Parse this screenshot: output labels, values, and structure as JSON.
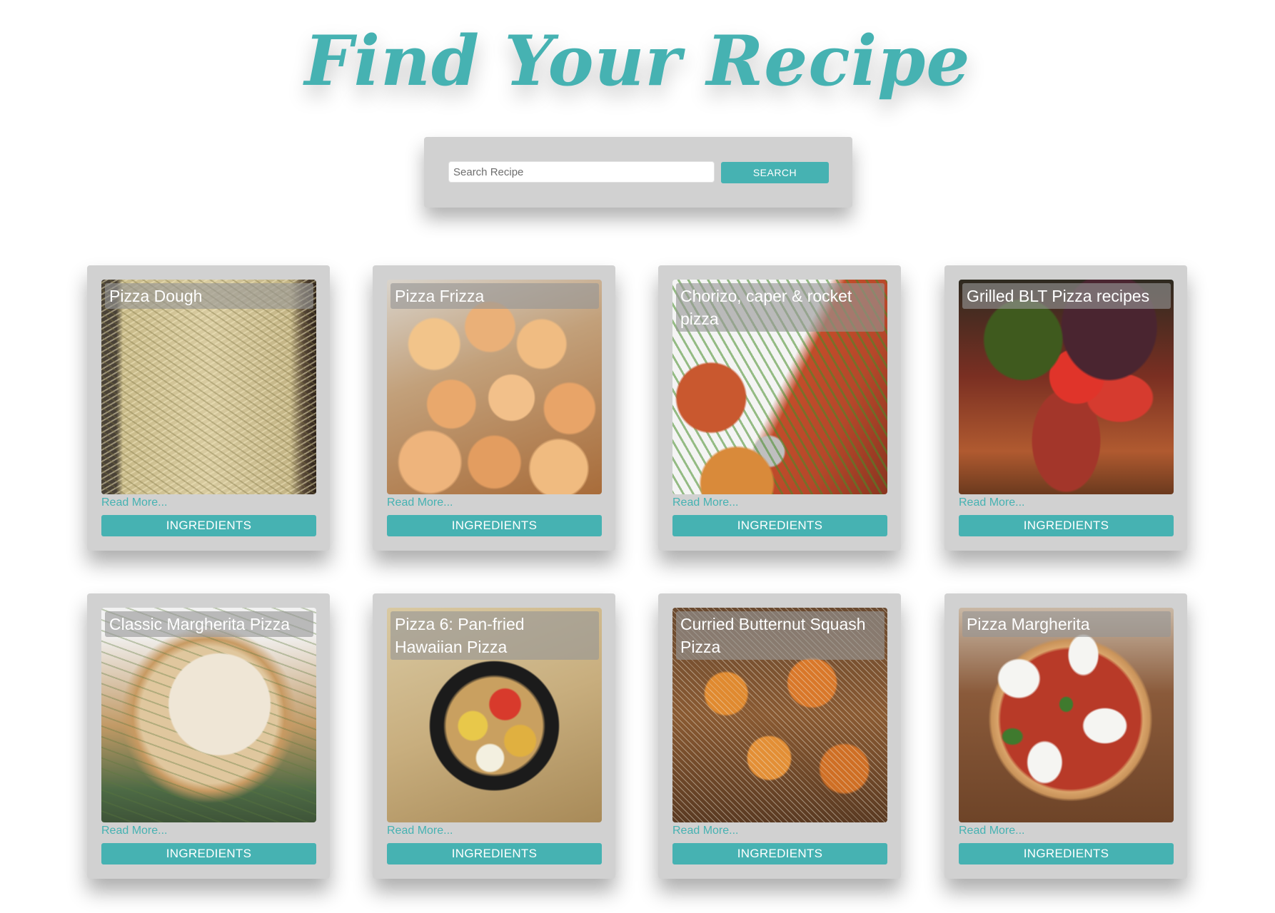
{
  "header": {
    "title": "Find Your Recipe"
  },
  "search": {
    "placeholder": "Search Recipe",
    "value": "",
    "button_label": "SEARCH"
  },
  "colors": {
    "accent": "#46b2b2",
    "panel": "#d1d1d1",
    "background": "#ffffff"
  },
  "recipes": [
    {
      "title": "Pizza Dough",
      "read_more": "Read More...",
      "button_label": "INGREDIENTS"
    },
    {
      "title": "Pizza Frizza",
      "read_more": "Read More...",
      "button_label": "INGREDIENTS"
    },
    {
      "title": "Chorizo, caper & rocket pizza",
      "read_more": "Read More...",
      "button_label": "INGREDIENTS"
    },
    {
      "title": "Grilled BLT Pizza recipes",
      "read_more": "Read More...",
      "button_label": "INGREDIENTS"
    },
    {
      "title": "Classic Margherita Pizza",
      "read_more": "Read More...",
      "button_label": "INGREDIENTS"
    },
    {
      "title": "Pizza 6: Pan-fried Hawaiian Pizza",
      "read_more": "Read More...",
      "button_label": "INGREDIENTS"
    },
    {
      "title": "Curried Butternut Squash Pizza",
      "read_more": "Read More...",
      "button_label": "INGREDIENTS"
    },
    {
      "title": "Pizza Margherita",
      "read_more": "Read More...",
      "button_label": "INGREDIENTS"
    }
  ]
}
